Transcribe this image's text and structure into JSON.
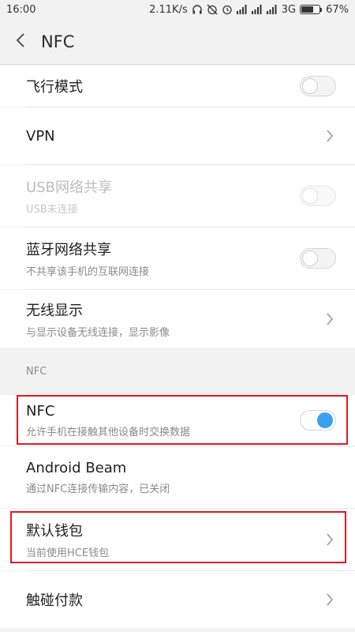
{
  "status_bar": {
    "time": "16:00",
    "net_speed": "2.11K/s",
    "network": "3G",
    "battery": "67%",
    "battery_level": 0.67,
    "icons": [
      "headphones-icon",
      "alarm-off-icon",
      "alarm-clock-icon",
      "signal-icon",
      "signal-icon",
      "signal-icon",
      "battery-icon"
    ]
  },
  "app_bar": {
    "title": "NFC",
    "back_icon": "back-arrow-icon"
  },
  "items": {
    "airplane": {
      "title": "飞行模式",
      "toggle_on": false
    },
    "vpn": {
      "title": "VPN"
    },
    "usb": {
      "title": "USB网络共享",
      "subtitle": "USB未连接",
      "toggle_on": false,
      "enabled": false
    },
    "bt": {
      "title": "蓝牙网络共享",
      "subtitle": "不共享该手机的互联网连接",
      "toggle_on": false
    },
    "wireless": {
      "title": "无线显示",
      "subtitle": "与显示设备无线连接，显示影像"
    },
    "nfc_header": "NFC",
    "nfc": {
      "title": "NFC",
      "subtitle": "允许手机在接触其他设备时交换数据",
      "toggle_on": true
    },
    "beam": {
      "title": "Android Beam",
      "subtitle": "通过NFC连接传输内容，已关闭"
    },
    "wallet": {
      "title": "默认钱包",
      "subtitle": "当前使用HCE钱包"
    },
    "tap_pay": {
      "title": "触碰付款"
    }
  },
  "colors": {
    "accent": "#3aa0f0",
    "highlight": "#e01b22",
    "background": "#f2f2f2"
  }
}
